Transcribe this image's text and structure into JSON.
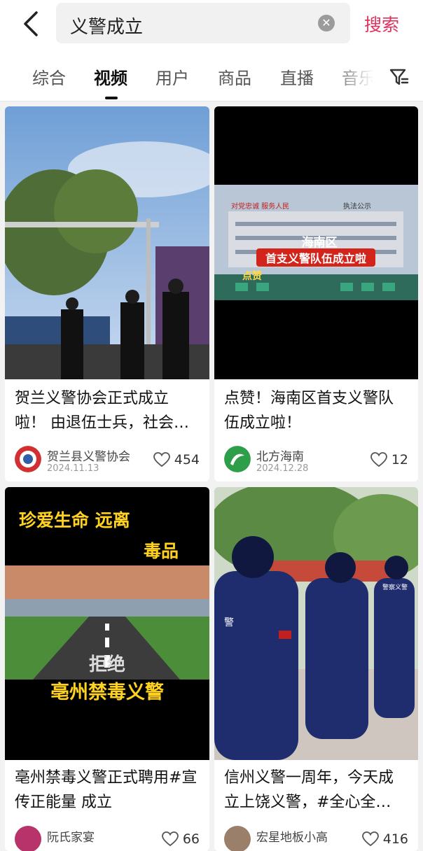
{
  "search": {
    "query": "义警成立",
    "button_label": "搜索"
  },
  "tabs": [
    "综合",
    "视频",
    "用户",
    "商品",
    "直播",
    "音乐"
  ],
  "cards": [
    {
      "title": "贺兰义警协会正式成立啦！ 由退伍士兵，社会…",
      "author": "贺兰县义警协会",
      "date": "2024.11.13",
      "likes": "454"
    },
    {
      "title": "点赞！海南区首支义警队伍成立啦！",
      "author": "北方海南",
      "date": "2024.12.28",
      "likes": "12",
      "overlay": {
        "line1": "海南区",
        "line2": "首支义警队伍成立啦",
        "like_text": "点赞",
        "slogan": "对党忠诚 服务人民",
        "sign": "执法公示"
      }
    },
    {
      "title": "亳州禁毒义警正式聘用#宣传正能量 成立",
      "author": "阮氏家宴",
      "likes": "66",
      "overlay": {
        "line1": "珍爱生命 远离",
        "line2": "毒品",
        "line3": "亳州禁毒义警",
        "road_text": "拒绝"
      }
    },
    {
      "title": "信州义警一周年，今天成立上饶义警，#全心全…",
      "author": "宏星地板小高",
      "likes": "416",
      "overlay": {
        "patch": "警",
        "back_text": "警察义警"
      }
    }
  ],
  "colors": {
    "accent": "#e0325f"
  }
}
